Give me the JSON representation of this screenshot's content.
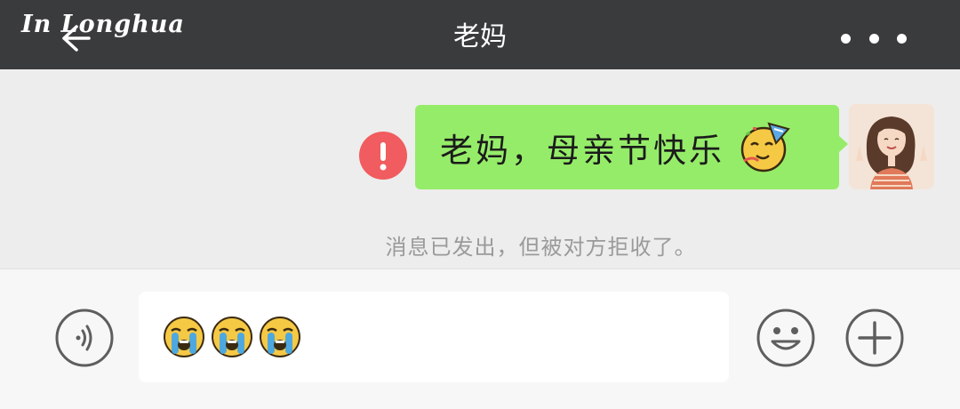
{
  "header": {
    "watermark": "In Longhua",
    "title": "老妈",
    "back_icon": "back-arrow-icon",
    "more_icon": "more-dots-icon",
    "background": "#3a3b3d"
  },
  "chat": {
    "messages": [
      {
        "sender": "self",
        "text": "老妈，母亲节快乐",
        "emoji": "partying-face-emoji",
        "bubble_color": "#95ec69",
        "failed": true
      }
    ],
    "status_text": "消息已发出，但被对方拒收了。",
    "error_color": "#f05c5f"
  },
  "input": {
    "voice_icon": "voice-icon",
    "content_emojis": [
      "crying-face-emoji",
      "crying-face-emoji",
      "crying-face-emoji"
    ],
    "emoji_button_icon": "smile-icon",
    "plus_button_icon": "plus-icon"
  }
}
